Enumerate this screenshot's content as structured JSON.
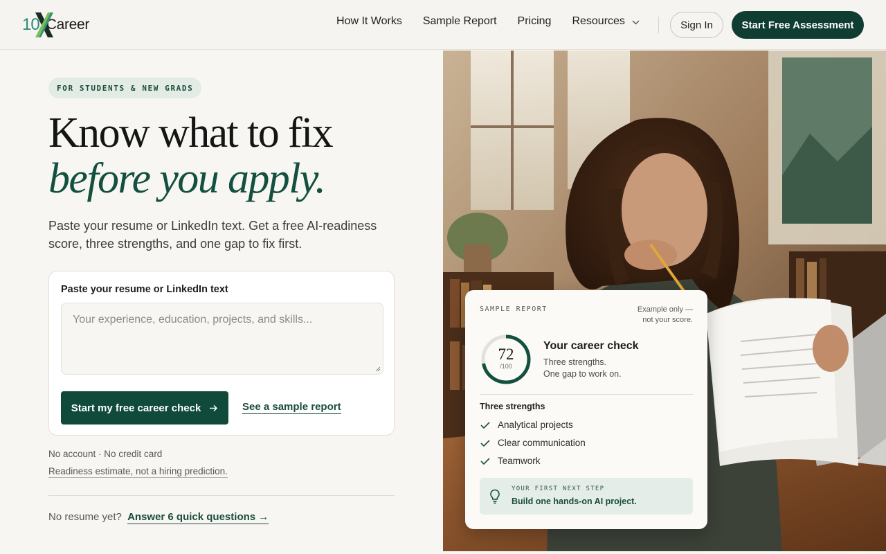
{
  "brand": {
    "logo_number": "10",
    "logo_word": "Career"
  },
  "nav": {
    "items": [
      "How It Works",
      "Sample Report",
      "Pricing",
      "Resources"
    ],
    "sign_in": "Sign In",
    "start_assessment": "Start Free Assessment"
  },
  "hero": {
    "pill": "FOR STUDENTS & NEW GRADS",
    "headline_line1": "Know what to fix",
    "headline_line2": "before you apply.",
    "lead": "Paste your resume or LinkedIn text. Get a free AI-readiness score, three strengths, and one gap to fix first."
  },
  "form": {
    "label": "Paste your resume or LinkedIn text",
    "placeholder": "Your experience, education, projects, and skills...",
    "submit": "Start my free career check",
    "sample_link": "See a sample report"
  },
  "notes": {
    "no_account": "No account · No credit card",
    "disclaimer": "Readiness estimate, not a hiring prediction.",
    "no_resume_prefix": "No resume yet?",
    "no_resume_link": "Answer 6 quick questions →"
  },
  "report": {
    "eyebrow": "SAMPLE REPORT",
    "note_line1": "Example only —",
    "note_line2": "not your score.",
    "score": "72",
    "score_max": "/100",
    "score_fraction": 0.72,
    "title": "Your career check",
    "sub1": "Three strengths.",
    "sub2": "One gap to work on.",
    "strengths_title": "Three strengths",
    "strengths": [
      "Analytical projects",
      "Clear communication",
      "Teamwork"
    ],
    "next_step_eyebrow": "YOUR FIRST NEXT STEP",
    "next_step": "Build one hands-on AI project."
  },
  "icons": {
    "chevron": "chevron-down-icon",
    "arrow": "arrow-right-icon",
    "check": "check-icon",
    "bulb": "lightbulb-icon"
  },
  "colors": {
    "brand_dark_green": "#0f3d31",
    "accent_green": "#13503f",
    "background": "#f8f6f2"
  }
}
